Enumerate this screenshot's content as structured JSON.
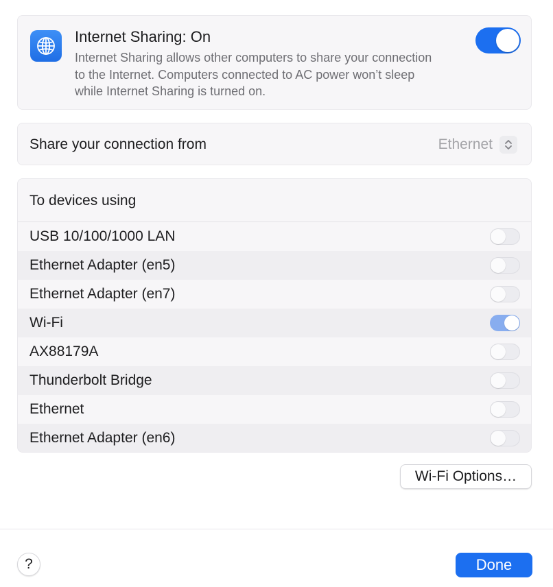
{
  "header": {
    "title": "Internet Sharing: On",
    "description": "Internet Sharing allows other computers to share your connection to the Internet. Computers connected to AC power won’t sleep while Internet Sharing is turned on.",
    "icon": "globe-icon",
    "enabled": true
  },
  "share_from": {
    "label": "Share your connection from",
    "selected": "Ethernet",
    "icon": "up-down-chevron-icon"
  },
  "devices": {
    "title": "To devices using",
    "items": [
      {
        "name": "USB 10/100/1000 LAN",
        "enabled": false
      },
      {
        "name": "Ethernet Adapter (en5)",
        "enabled": false
      },
      {
        "name": "Ethernet Adapter (en7)",
        "enabled": false
      },
      {
        "name": "Wi-Fi",
        "enabled": true
      },
      {
        "name": "AX88179A",
        "enabled": false
      },
      {
        "name": "Thunderbolt Bridge",
        "enabled": false
      },
      {
        "name": "Ethernet",
        "enabled": false
      },
      {
        "name": "Ethernet Adapter (en6)",
        "enabled": false
      }
    ]
  },
  "buttons": {
    "wifi_options": "Wi-Fi Options…",
    "help": "?",
    "done": "Done"
  },
  "colors": {
    "accent": "#1c6ff0",
    "toggle_on_dimmed": "#88adef"
  }
}
